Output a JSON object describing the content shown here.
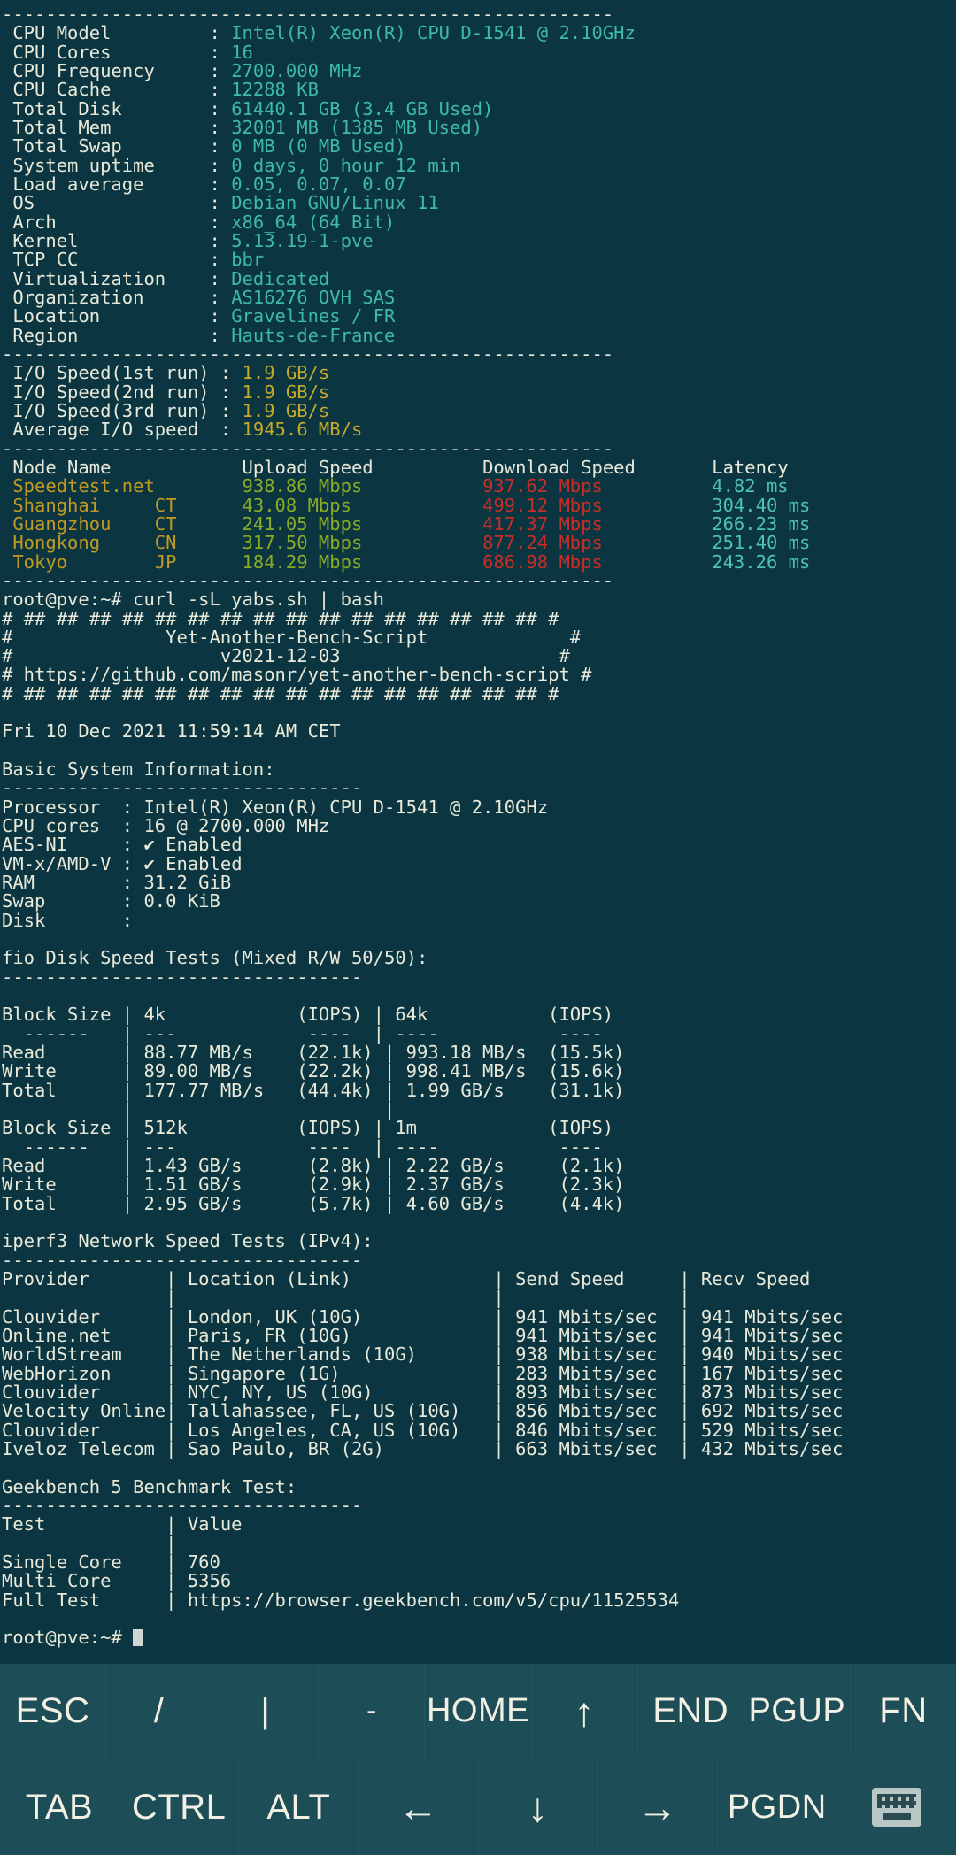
{
  "terminal": {
    "colors": {
      "background": "#0b3641",
      "default_text": "#e9e9da",
      "cyan": "#3fb8ac",
      "yellow": "#c5a92a",
      "gold": "#c09a22",
      "green": "#8aab26",
      "red": "#c52f27"
    },
    "divider": "--------------------------------------------------------",
    "sysinfo": {
      "rows": [
        {
          "label": "CPU Model",
          "value": "Intel(R) Xeon(R) CPU D-1541 @ 2.10GHz"
        },
        {
          "label": "CPU Cores",
          "value": "16"
        },
        {
          "label": "CPU Frequency",
          "value": "2700.000 MHz"
        },
        {
          "label": "CPU Cache",
          "value": "12288 KB"
        },
        {
          "label": "Total Disk",
          "value": "61440.1 GB (3.4 GB Used)"
        },
        {
          "label": "Total Mem",
          "value": "32001 MB (1385 MB Used)"
        },
        {
          "label": "Total Swap",
          "value": "0 MB (0 MB Used)"
        },
        {
          "label": "System uptime",
          "value": "0 days, 0 hour 12 min"
        },
        {
          "label": "Load average",
          "value": "0.05, 0.07, 0.07"
        },
        {
          "label": "OS",
          "value": "Debian GNU/Linux 11"
        },
        {
          "label": "Arch",
          "value": "x86_64 (64 Bit)"
        },
        {
          "label": "Kernel",
          "value": "5.13.19-1-pve"
        },
        {
          "label": "TCP CC",
          "value": "bbr"
        },
        {
          "label": "Virtualization",
          "value": "Dedicated"
        },
        {
          "label": "Organization",
          "value": "AS16276 OVH SAS"
        },
        {
          "label": "Location",
          "value": "Gravelines / FR"
        },
        {
          "label": "Region",
          "value": "Hauts-de-France"
        }
      ]
    },
    "iospeed": {
      "rows": [
        {
          "label": "I/O Speed(1st run)",
          "value": "1.9 GB/s"
        },
        {
          "label": "I/O Speed(2nd run)",
          "value": "1.9 GB/s"
        },
        {
          "label": "I/O Speed(3rd run)",
          "value": "1.9 GB/s"
        },
        {
          "label": "Average I/O speed",
          "value": "1945.6 MB/s"
        }
      ]
    },
    "speedtest": {
      "headers": [
        "Node Name",
        "Upload Speed",
        "Download Speed",
        "Latency"
      ],
      "rows": [
        {
          "node": "Speedtest.net",
          "isp": "",
          "upload": "938.86 Mbps",
          "download": "937.62 Mbps",
          "latency": "4.82 ms"
        },
        {
          "node": "Shanghai",
          "isp": "CT",
          "upload": "43.08 Mbps",
          "download": "499.12 Mbps",
          "latency": "304.40 ms"
        },
        {
          "node": "Guangzhou",
          "isp": "CT",
          "upload": "241.05 Mbps",
          "download": "417.37 Mbps",
          "latency": "266.23 ms"
        },
        {
          "node": "Hongkong",
          "isp": "CN",
          "upload": "317.50 Mbps",
          "download": "877.24 Mbps",
          "latency": "251.40 ms"
        },
        {
          "node": "Tokyo",
          "isp": "JP",
          "upload": "184.29 Mbps",
          "download": "686.98 Mbps",
          "latency": "243.26 ms"
        }
      ]
    },
    "prompt": {
      "user_host": "root@pve:~#",
      "command": " curl -sL yabs.sh | bash"
    },
    "banner": {
      "hash_row": "# ## ## ## ## ## ## ## ## ## ## ## ## ## ## ## ## #",
      "line_title": "#              Yet-Another-Bench-Script             #",
      "line_version": "#                   v2021-12-03                    #",
      "line_url": "# https://github.com/masonr/yet-another-bench-script #"
    },
    "timestamp": "Fri 10 Dec 2021 11:59:14 AM CET",
    "basic_info": {
      "heading": "Basic System Information:",
      "rule": "---------------------------------",
      "rows": [
        {
          "label": "Processor ",
          "value": "Intel(R) Xeon(R) CPU D-1541 @ 2.10GHz"
        },
        {
          "label": "CPU cores ",
          "value": "16 @ 2700.000 MHz"
        },
        {
          "label": "AES-NI    ",
          "value": "✔ Enabled"
        },
        {
          "label": "VM-x/AMD-V",
          "value": "✔ Enabled"
        },
        {
          "label": "RAM       ",
          "value": "31.2 GiB"
        },
        {
          "label": "Swap      ",
          "value": "0.0 KiB"
        },
        {
          "label": "Disk      ",
          "value": ""
        }
      ]
    },
    "fio": {
      "heading": "fio Disk Speed Tests (Mixed R/W 50/50):",
      "rule": "---------------------------------",
      "block1": {
        "header": "Block Size | 4k            (IOPS) | 64k           (IOPS)",
        "sep": "  ------   | ---            ----  | ----           ---- ",
        "read": "Read       | 88.77 MB/s    (22.1k) | 993.18 MB/s  (15.5k)",
        "write": "Write      | 89.00 MB/s    (22.2k) | 998.41 MB/s  (15.6k)",
        "total": "Total      | 177.77 MB/s   (44.4k) | 1.99 GB/s    (31.1k)",
        "blank": "           |                       |                    "
      },
      "block2": {
        "header": "Block Size | 512k          (IOPS) | 1m            (IOPS)",
        "sep": "  ------   | ---            ----  | ----           ---- ",
        "read": "Read       | 1.43 GB/s      (2.8k) | 2.22 GB/s     (2.1k)",
        "write": "Write      | 1.51 GB/s      (2.9k) | 2.37 GB/s     (2.3k)",
        "total": "Total      | 2.95 GB/s      (5.7k) | 4.60 GB/s     (4.4k)"
      }
    },
    "iperf": {
      "heading": "iperf3 Network Speed Tests (IPv4):",
      "rule": "---------------------------------",
      "headers": [
        "Provider",
        "Location (Link)",
        "Send Speed",
        "Recv Speed"
      ],
      "rows": [
        {
          "provider": "Clouvider",
          "location": "London, UK (10G)",
          "send": "941 Mbits/sec",
          "recv": "941 Mbits/sec"
        },
        {
          "provider": "Online.net",
          "location": "Paris, FR (10G)",
          "send": "941 Mbits/sec",
          "recv": "941 Mbits/sec"
        },
        {
          "provider": "WorldStream",
          "location": "The Netherlands (10G)",
          "send": "938 Mbits/sec",
          "recv": "940 Mbits/sec"
        },
        {
          "provider": "WebHorizon",
          "location": "Singapore (1G)",
          "send": "283 Mbits/sec",
          "recv": "167 Mbits/sec"
        },
        {
          "provider": "Clouvider",
          "location": "NYC, NY, US (10G)",
          "send": "893 Mbits/sec",
          "recv": "873 Mbits/sec"
        },
        {
          "provider": "Velocity Online",
          "location": "Tallahassee, FL, US (10G)",
          "send": "856 Mbits/sec",
          "recv": "692 Mbits/sec"
        },
        {
          "provider": "Clouvider",
          "location": "Los Angeles, CA, US (10G)",
          "send": "846 Mbits/sec",
          "recv": "529 Mbits/sec"
        },
        {
          "provider": "Iveloz Telecom",
          "location": "Sao Paulo, BR (2G)",
          "send": "663 Mbits/sec",
          "recv": "432 Mbits/sec"
        }
      ]
    },
    "geekbench": {
      "heading": "Geekbench 5 Benchmark Test:",
      "rule": "---------------------------------",
      "headers": [
        "Test",
        "Value"
      ],
      "rows": [
        {
          "test": "Single Core",
          "value": "760"
        },
        {
          "test": "Multi Core",
          "value": "5356"
        },
        {
          "test": "Full Test",
          "value": "https://browser.geekbench.com/v5/cpu/11525534"
        }
      ]
    },
    "final_prompt": "root@pve:~#"
  },
  "keybar": {
    "row1": [
      {
        "label": "ESC",
        "name": "key-esc"
      },
      {
        "label": "/",
        "name": "key-slash"
      },
      {
        "label": "|",
        "name": "key-pipe"
      },
      {
        "label": "-",
        "name": "key-dash"
      },
      {
        "label": "HOME",
        "name": "key-home"
      },
      {
        "label": "↑",
        "name": "key-arrow-up"
      },
      {
        "label": "END",
        "name": "key-end"
      },
      {
        "label": "PGUP",
        "name": "key-pgup"
      },
      {
        "label": "FN",
        "name": "key-fn"
      }
    ],
    "row2": [
      {
        "label": "TAB",
        "name": "key-tab"
      },
      {
        "label": "CTRL",
        "name": "key-ctrl"
      },
      {
        "label": "ALT",
        "name": "key-alt"
      },
      {
        "label": "←",
        "name": "key-arrow-left"
      },
      {
        "label": "↓",
        "name": "key-arrow-down"
      },
      {
        "label": "→",
        "name": "key-arrow-right"
      },
      {
        "label": "PGDN",
        "name": "key-pgdn"
      },
      {
        "label": "",
        "name": "keyboard-icon"
      }
    ]
  }
}
